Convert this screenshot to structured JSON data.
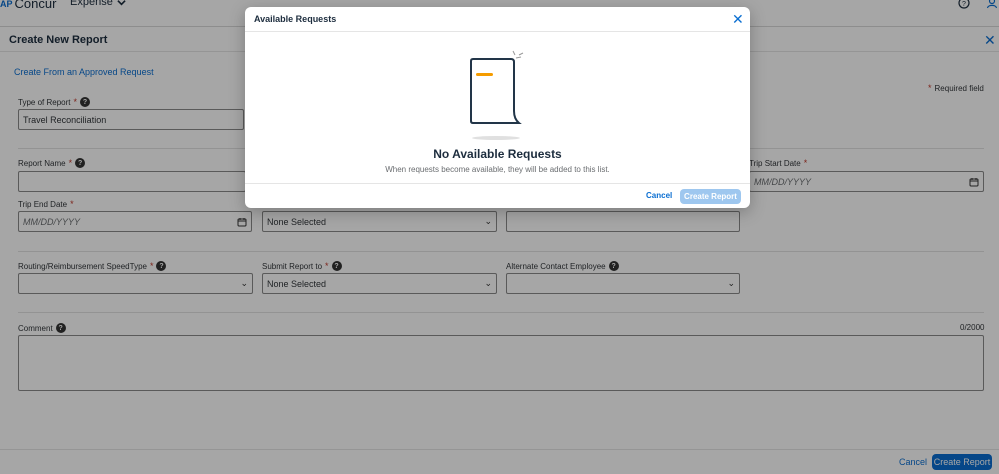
{
  "topnav": {
    "brand_prefix": "AP",
    "brand_name": "Concur",
    "menu_label": "Expense",
    "menu_chevron": "chevron-down-icon",
    "help_icon": "help-circle-icon",
    "user_icon": "user-icon"
  },
  "panel": {
    "title": "Create New Report",
    "create_from_link": "Create From an Approved Request",
    "required_note": "Required field",
    "required_marker": "*",
    "fields": {
      "type_of_report": {
        "label": "Type of Report",
        "value": "Travel Reconciliation"
      },
      "report_name": {
        "label": "Report Name",
        "value": ""
      },
      "trip_start_date": {
        "label": "Trip Start Date",
        "placeholder": "MM/DD/YYYY"
      },
      "trip_end_date": {
        "label": "Trip End Date",
        "placeholder": "MM/DD/YYYY"
      },
      "middle_select": {
        "value": "None Selected"
      },
      "routing": {
        "label": "Routing/Reimbursement SpeedType",
        "value": ""
      },
      "submit_to": {
        "label": "Submit Report to",
        "value": "None Selected"
      },
      "alternate_contact": {
        "label": "Alternate Contact Employee",
        "value": ""
      },
      "comment": {
        "label": "Comment",
        "counter": "0/2000"
      }
    },
    "footer": {
      "cancel_label": "Cancel",
      "create_label": "Create Report"
    }
  },
  "modal": {
    "title": "Available Requests",
    "empty_title": "No Available Requests",
    "empty_subtitle": "When requests become available, they will be added to this list.",
    "cancel_label": "Cancel",
    "create_label": "Create Report"
  },
  "colors": {
    "accent": "#0a6ed1",
    "accent_disabled": "#9ec7ef",
    "required": "#c0392b",
    "illustration_orange": "#f59c00",
    "illustration_outline": "#223548"
  }
}
